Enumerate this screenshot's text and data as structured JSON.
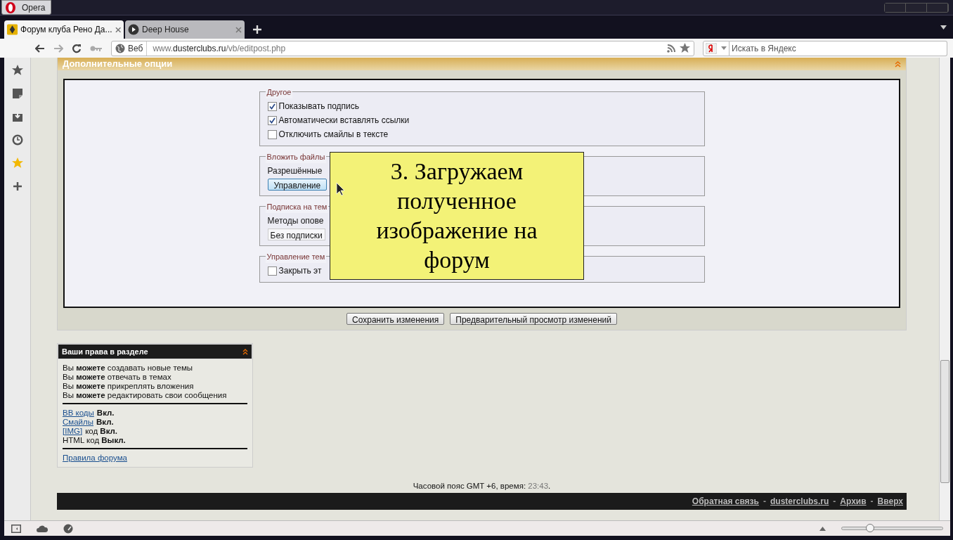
{
  "app_button": "Opera",
  "tabs": [
    {
      "label": "Форум клуба Рено Да...",
      "selected": true
    },
    {
      "label": "Deep House",
      "selected": false
    }
  ],
  "address_bar": {
    "scope": "Веб",
    "url_prefix": "www.",
    "url_domain": "dusterclubs.ru",
    "url_path": "/vb/editpost.php"
  },
  "search": {
    "placeholder": "Искать в Яндекс"
  },
  "options_panel": {
    "title": "Дополнительные опции",
    "groups": [
      {
        "legend": "Другое",
        "items": [
          {
            "kind": "checkbox",
            "label": "Показывать подпись",
            "checked": true
          },
          {
            "kind": "checkbox",
            "label": "Автоматически вставлять ссылки",
            "checked": true
          },
          {
            "kind": "checkbox",
            "label": "Отключить смайлы в тексте",
            "checked": false
          }
        ]
      },
      {
        "legend": "Вложить файлы",
        "items": [
          {
            "kind": "text",
            "label": "Разрешённые"
          },
          {
            "kind": "button",
            "label": "Управление"
          }
        ]
      },
      {
        "legend": "Подписка на тем",
        "items": [
          {
            "kind": "text",
            "label": "Методы опове"
          },
          {
            "kind": "select",
            "label": "Без подписки"
          }
        ]
      },
      {
        "legend": "Управление тем",
        "items": [
          {
            "kind": "checkbox",
            "label": "Закрыть эт",
            "checked": false
          }
        ]
      }
    ]
  },
  "buttons": [
    "Сохранить изменения",
    "Предварительный просмотр изменений"
  ],
  "overlay_note": "3. Загружаем полученное изображение на форум",
  "rights_box": {
    "title": "Ваши права в разделе",
    "permissions": [
      "Вы **можете** создавать новые темы",
      "Вы **можете** отвечать в темах",
      "Вы **можете** прикреплять вложения",
      "Вы **можете** редактировать свои сообщения"
    ],
    "codes": [
      {
        "link": "BB коды",
        "text": "**Вкл.**"
      },
      {
        "link": "Смайлы",
        "text": "**Вкл.**"
      },
      {
        "link": "[IMG]",
        "text": "код **Вкл.**"
      },
      {
        "text": "HTML код **Выкл.**"
      }
    ],
    "rules_link": "Правила форума"
  },
  "timezone": {
    "label": "Часовой пояс GMT +6, время:",
    "time": "23:43",
    "end": "."
  },
  "footer_links": [
    "Обратная связь",
    "dusterclubs.ru",
    "Архив",
    "Вверх"
  ],
  "footer_separator": "-",
  "zoom_slider": {
    "level": 0.28
  }
}
